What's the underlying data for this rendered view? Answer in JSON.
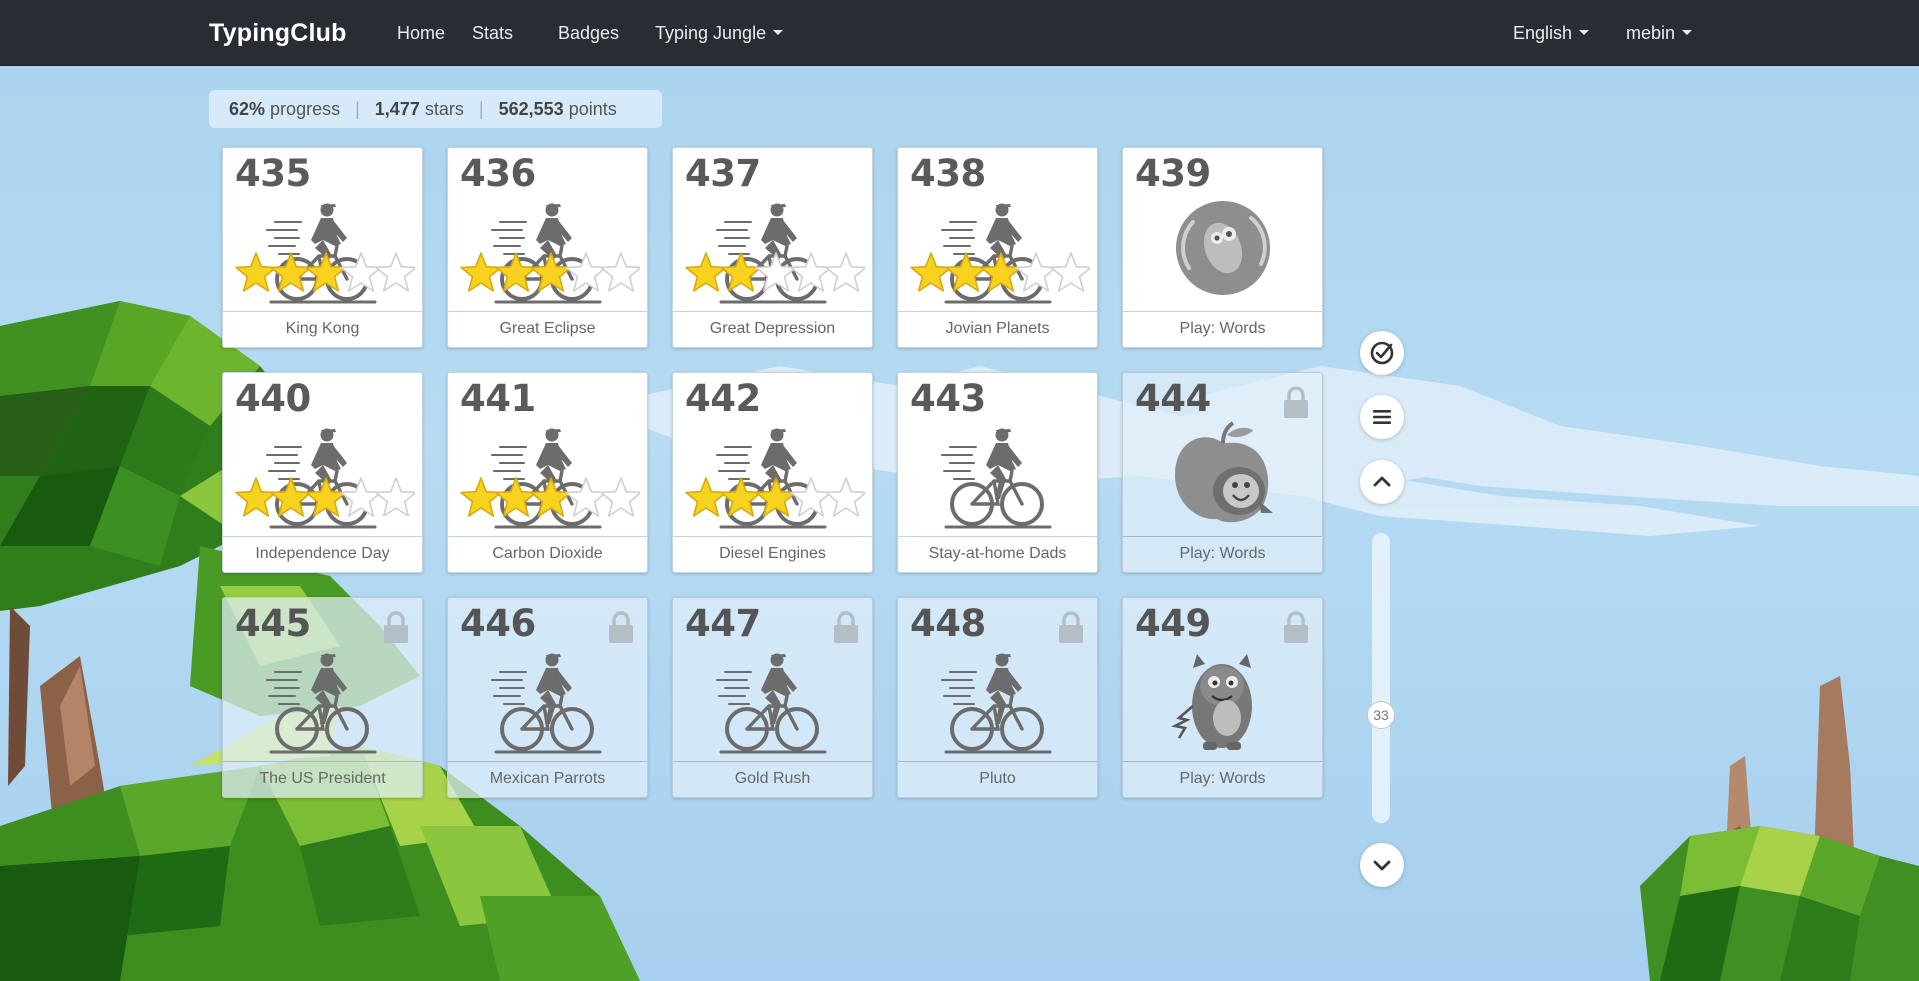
{
  "nav": {
    "brand": "TypingClub",
    "home": "Home",
    "stats": "Stats",
    "badges": "Badges",
    "typing_jungle": "Typing Jungle",
    "language": "English",
    "user": "mebin"
  },
  "status": {
    "progress_value": "62%",
    "progress_label": "progress",
    "stars_value": "1,477",
    "stars_label": "stars",
    "points_value": "562,553",
    "points_label": "points"
  },
  "lessons": [
    {
      "number": "435",
      "title": "King Kong",
      "icon": "cyclist-icon",
      "stars": 3,
      "locked": false
    },
    {
      "number": "436",
      "title": "Great Eclipse",
      "icon": "cyclist-icon",
      "stars": 3,
      "locked": false
    },
    {
      "number": "437",
      "title": "Great Depression",
      "icon": "cyclist-icon",
      "stars": 2,
      "locked": false
    },
    {
      "number": "438",
      "title": "Jovian Planets",
      "icon": "cyclist-icon",
      "stars": 3,
      "locked": false
    },
    {
      "number": "439",
      "title": "Play: Words",
      "icon": "game-creature-icon",
      "stars": 0,
      "locked": false
    },
    {
      "number": "440",
      "title": "Independence Day",
      "icon": "cyclist-icon",
      "stars": 3,
      "locked": false
    },
    {
      "number": "441",
      "title": "Carbon Dioxide",
      "icon": "cyclist-icon",
      "stars": 3,
      "locked": false
    },
    {
      "number": "442",
      "title": "Diesel Engines",
      "icon": "cyclist-icon",
      "stars": 3,
      "locked": false
    },
    {
      "number": "443",
      "title": "Stay-at-home Dads",
      "icon": "cyclist-icon",
      "stars": 0,
      "locked": false
    },
    {
      "number": "444",
      "title": "Play: Words",
      "icon": "apple-creature-icon",
      "stars": 0,
      "locked": true
    },
    {
      "number": "445",
      "title": "The US President",
      "icon": "cyclist-icon",
      "stars": 0,
      "locked": true
    },
    {
      "number": "446",
      "title": "Mexican Parrots",
      "icon": "cyclist-icon",
      "stars": 0,
      "locked": true
    },
    {
      "number": "447",
      "title": "Gold Rush",
      "icon": "cyclist-icon",
      "stars": 0,
      "locked": true
    },
    {
      "number": "448",
      "title": "Pluto",
      "icon": "cyclist-icon",
      "stars": 0,
      "locked": true
    },
    {
      "number": "449",
      "title": "Play: Words",
      "icon": "monster-creature-icon",
      "stars": 0,
      "locked": true
    }
  ],
  "scroll": {
    "indicator": "33"
  },
  "colors": {
    "navbar": "#272d33",
    "star_gold": "#f7d21e",
    "icon_gray": "#6c6c6c"
  }
}
